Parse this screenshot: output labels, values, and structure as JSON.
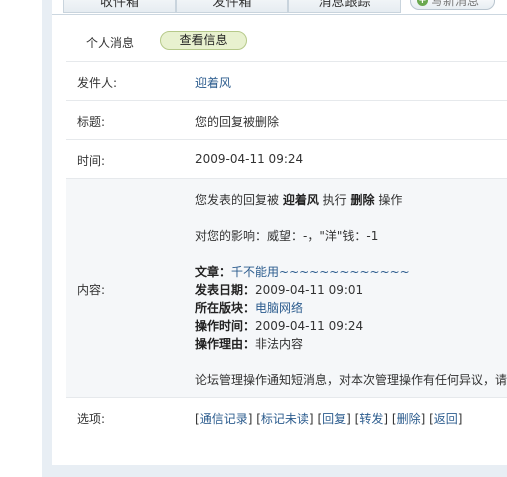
{
  "tabs": {
    "inbox": "收件箱",
    "outbox": "发件箱",
    "track": "消息跟踪"
  },
  "compose": {
    "label": "写新消息"
  },
  "subtabs": {
    "personal": "个人消息",
    "view": "查看信息"
  },
  "fields": {
    "sender_label": "发件人:",
    "sender_value": "迎着风",
    "title_label": "标题:",
    "title_value": "您的回复被删除",
    "time_label": "时间:",
    "time_value": "2009-04-11 09:24",
    "content_label": "内容:",
    "options_label": "选项:"
  },
  "content": {
    "line1_prefix": "您发表的回复被 ",
    "line1_actor": "迎着风",
    "line1_mid": " 执行 ",
    "line1_action": "删除",
    "line1_suffix": " 操作",
    "line2": "对您的影响：威望：-，\"洋\"钱：-1",
    "article_label": "文章：",
    "article_value": "千不能用~~~~~~~~~~~~~",
    "date_label": "发表日期：",
    "date_value": "2009-04-11 09:01",
    "forum_label": "所在版块：",
    "forum_value": "电脑网络",
    "optime_label": "操作时间：",
    "optime_value": "2009-04-11 09:24",
    "reason_label": "操作理由：",
    "reason_value": "非法内容",
    "notice": "论坛管理操作通知短消息，对本次管理操作有任何异议，请"
  },
  "options": [
    "通信记录",
    "标记未读",
    "回复",
    "转发",
    "删除",
    "返回"
  ]
}
